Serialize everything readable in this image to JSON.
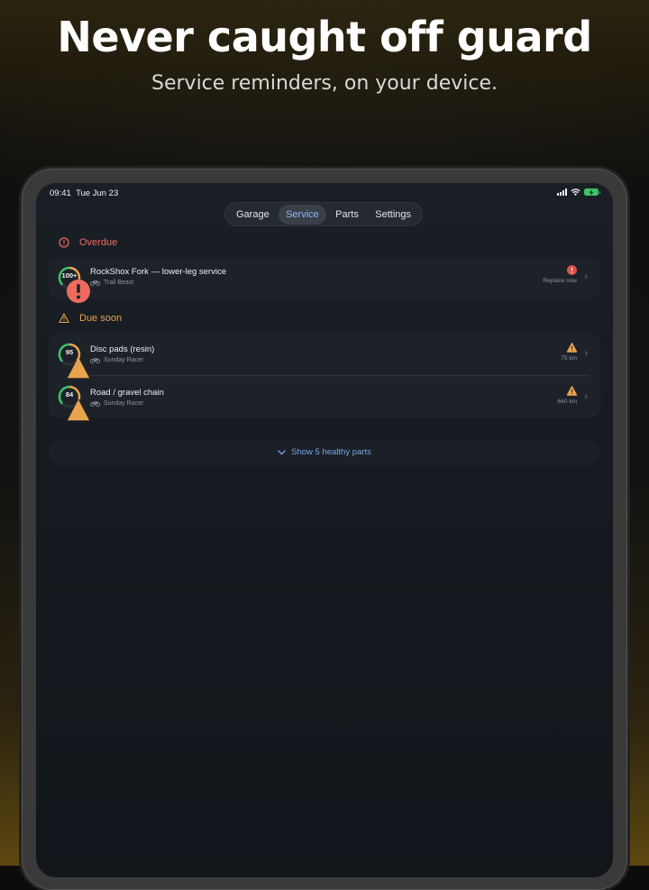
{
  "promo": {
    "headline": "Never caught off guard",
    "subheadline": "Service reminders, on your device."
  },
  "status_bar": {
    "time": "09:41",
    "date": "Tue Jun 23"
  },
  "tabs": [
    {
      "label": "Garage",
      "active": false
    },
    {
      "label": "Service",
      "active": true
    },
    {
      "label": "Parts",
      "active": false
    },
    {
      "label": "Settings",
      "active": false
    }
  ],
  "sections": {
    "overdue": {
      "title": "Overdue",
      "icon": "alert-circle-icon",
      "color": "#ef6b5f",
      "items": [
        {
          "title": "RockShox Fork — lower-leg service",
          "bike": "Trail Beast",
          "ring_value": "100+",
          "status_text": "Replace now",
          "status_icon": "exclamation-circle-icon"
        }
      ]
    },
    "due_soon": {
      "title": "Due soon",
      "icon": "warning-triangle-icon",
      "color": "#e9a34e",
      "items": [
        {
          "title": "Disc pads (resin)",
          "bike": "Sunday Racer",
          "ring_value": "95",
          "status_text": "75 km",
          "status_icon": "warning-triangle-icon"
        },
        {
          "title": "Road / gravel chain",
          "bike": "Sunday Racer",
          "ring_value": "84",
          "status_text": "640 km",
          "status_icon": "warning-triangle-icon"
        }
      ]
    }
  },
  "show_healthy_label": "Show 5 healthy parts",
  "colors": {
    "accent": "#79a6e8",
    "overdue": "#ef6b5f",
    "warning": "#e9a34e",
    "ring_green": "#3fbf6a",
    "ring_amber": "#e9a34e"
  }
}
